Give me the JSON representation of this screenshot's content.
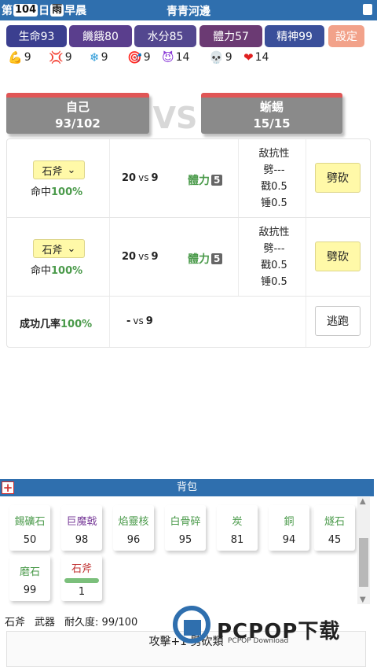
{
  "header": {
    "day_prefix": "第",
    "day_number": "104",
    "day_suffix": "日",
    "weather": "雨",
    "time_of_day": "早晨",
    "location": "青青河邊"
  },
  "stats": [
    {
      "label": "生命93"
    },
    {
      "label": "饑餓80"
    },
    {
      "label": "水分85"
    },
    {
      "label": "體力57"
    },
    {
      "label": "精神99"
    }
  ],
  "settings_label": "設定",
  "icon_stats": [
    {
      "icon": "muscle-icon",
      "glyph": "💪",
      "value": "9"
    },
    {
      "icon": "anger-icon",
      "glyph": "💢",
      "value": "9"
    },
    {
      "icon": "snowflake-icon",
      "glyph": "❄",
      "value": "9"
    },
    {
      "icon": "target-icon",
      "glyph": "🎯",
      "value": "9"
    },
    {
      "icon": "devil-icon",
      "glyph": "😈",
      "value": "14"
    },
    {
      "icon": "skull-icon",
      "glyph": "💀",
      "value": "9"
    },
    {
      "icon": "heart-icon",
      "glyph": "❤",
      "value": "14"
    }
  ],
  "battle": {
    "self": {
      "name": "自己",
      "hp": "93/102"
    },
    "vs": "VS",
    "enemy": {
      "name": "蜥蜴",
      "hp": "15/15"
    },
    "attacks": [
      {
        "weapon": "石斧",
        "hit_label": "命中",
        "hit_pct": "100%",
        "dmg_self": "20",
        "vs": "vs",
        "dmg_enemy": "9",
        "stamina_label": "體力",
        "stamina_cost": "5",
        "resist_title": "敌抗性",
        "resist_chop": "劈---",
        "resist_stab": "戳0.5",
        "resist_hammer": "锤0.5",
        "action": "劈砍"
      },
      {
        "weapon": "石斧",
        "hit_label": "命中",
        "hit_pct": "100%",
        "dmg_self": "20",
        "vs": "vs",
        "dmg_enemy": "9",
        "stamina_label": "體力",
        "stamina_cost": "5",
        "resist_title": "敌抗性",
        "resist_chop": "劈---",
        "resist_stab": "戳0.5",
        "resist_hammer": "锤0.5",
        "action": "劈砍"
      }
    ],
    "escape": {
      "label": "成功几率",
      "pct": "100%",
      "self": "-",
      "vs": "vs",
      "enemy": "9",
      "action": "逃跑"
    }
  },
  "bag": {
    "title": "背包",
    "items": [
      {
        "name": "錫礦石",
        "count": "50",
        "color": "green"
      },
      {
        "name": "巨魔戟",
        "count": "98",
        "color": "purple"
      },
      {
        "name": "焰靈核",
        "count": "96",
        "color": "green"
      },
      {
        "name": "白骨碎",
        "count": "95",
        "color": "green"
      },
      {
        "name": "炭",
        "count": "81",
        "color": "green"
      },
      {
        "name": "銅",
        "count": "94",
        "color": "green"
      },
      {
        "name": "燧石",
        "count": "45",
        "color": "green"
      },
      {
        "name": "磨石",
        "count": "99",
        "color": "green"
      },
      {
        "name": "石斧",
        "count": "1",
        "color": "red",
        "durability": 0.99
      }
    ]
  },
  "selected_item": {
    "name": "石斧",
    "type": "武器",
    "durability_label": "耐久度: 99/100"
  },
  "action_text": "攻擊+1  劈砍類",
  "watermark": {
    "text": "PCPOP下载",
    "sub": "PCPOP Download"
  }
}
